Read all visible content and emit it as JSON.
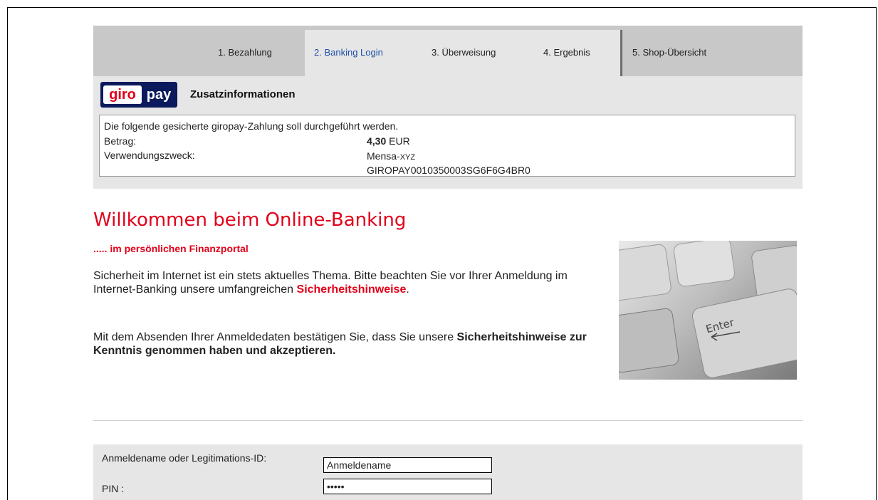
{
  "tabs": [
    {
      "label": "1. Bezahlung"
    },
    {
      "label": "2. Banking Login"
    },
    {
      "label": "3. Überweisung"
    },
    {
      "label": "4. Ergebnis"
    },
    {
      "label": "5. Shop-Übersicht"
    }
  ],
  "logo": {
    "part1": "giro",
    "part2": "pay"
  },
  "info": {
    "heading": "Zusatzinformationen",
    "intro": "Die folgende gesicherte giropay-Zahlung soll durchgeführt werden.",
    "betrag_label": "Betrag:",
    "betrag_value": "4,30",
    "betrag_currency": "EUR",
    "vz_label": "Verwendungszweck:",
    "vz_line1_a": "Mensa-",
    "vz_line1_b": "XYZ",
    "vz_line2": "GIROPAY0010350003SG6F6G4BR0"
  },
  "welcome": {
    "title": "Willkommen beim Online-Banking",
    "subtitle": "..... im persönlichen Finanzportal",
    "para1": "Sicherheit im Internet ist ein stets aktuelles Thema. Bitte beachten Sie vor Ihrer Anmeldung im Internet-Banking unsere umfangreichen",
    "para1_link": "Sicherheitshinweise",
    "para1_end": ".",
    "para2": "Mit dem Absenden Ihrer Anmeldedaten bestätigen Sie, dass Sie unsere",
    "para2_bold": "Sicherheitshinweise zur Kenntnis genommen haben und akzeptieren."
  },
  "keyboard_image": {
    "key_label": "Enter"
  },
  "login": {
    "username_label": "Anmeldename oder Legitimations-ID:",
    "username_value": "Anmeldename",
    "pin_label": "PIN :",
    "pin_value": "•••••"
  },
  "colors": {
    "brand_red": "#e2001a",
    "active_tab_text": "#1f4fa8",
    "giropay_blue": "#0a1a5c"
  }
}
